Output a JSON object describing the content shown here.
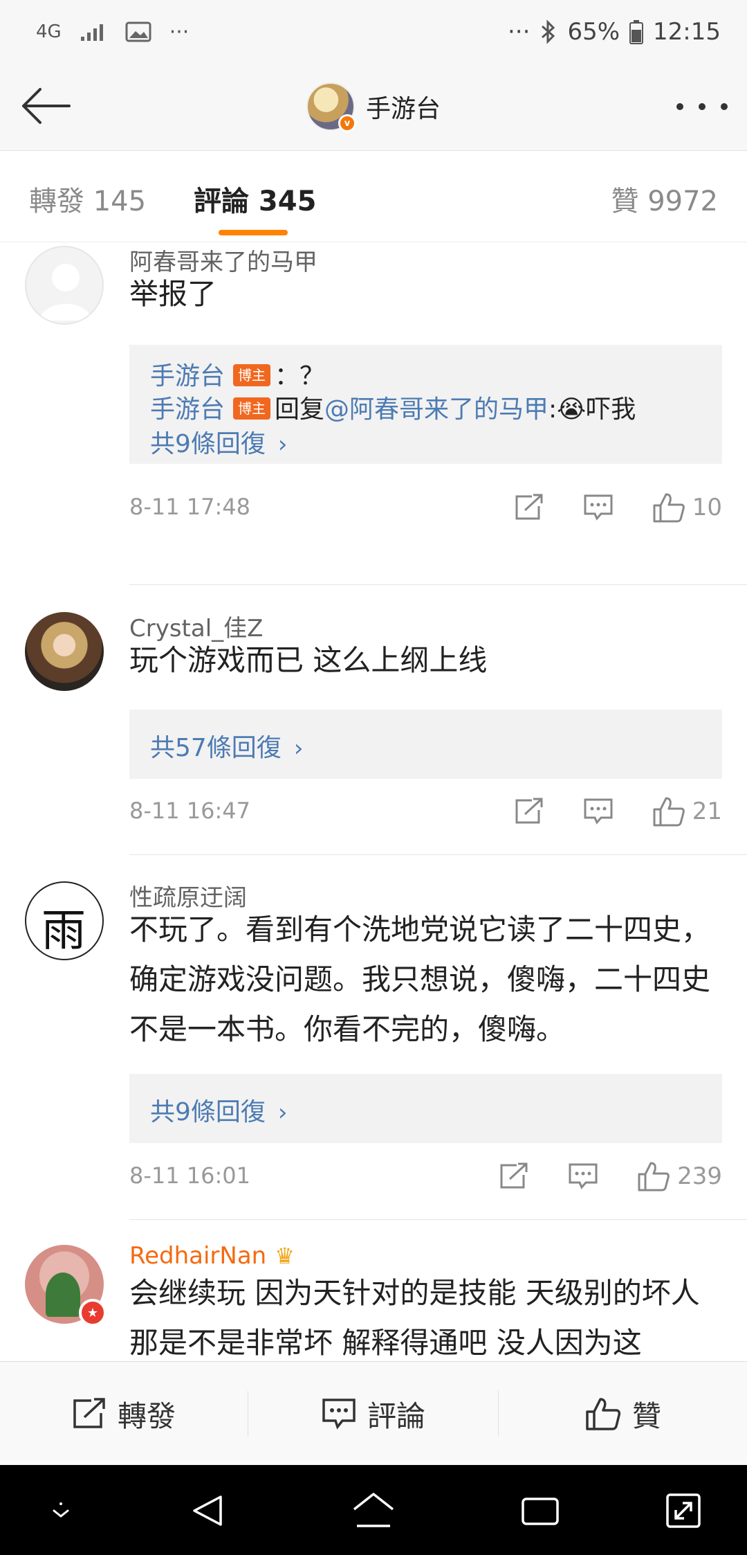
{
  "status_bar": {
    "network": "4G",
    "more": "···",
    "bt_more": "···",
    "battery": "65%",
    "time": "12:15"
  },
  "nav": {
    "title": "手游台"
  },
  "tabs": {
    "repost": "轉發 145",
    "comments": "評論 345",
    "likes": "贊 9972",
    "active": "comments",
    "accent": "#ff8200"
  },
  "comments": [
    {
      "user": "阿春哥来了的马甲",
      "text": "举报了",
      "replies": [
        {
          "name": "手游台",
          "tag": "博主",
          "content": "：？"
        },
        {
          "name": "手游台",
          "tag": "博主",
          "reply_prefix": "回复",
          "mention": "@阿春哥来了的马甲",
          "content": ":😭吓我"
        }
      ],
      "reply_more": "共9條回復",
      "time": "8-11 17:48",
      "likes": "10"
    },
    {
      "user": "Crystal_佳Z",
      "text": "玩个游戏而已 这么上纲上线",
      "reply_more": "共57條回復",
      "time": "8-11 16:47",
      "likes": "21"
    },
    {
      "user": "性疏原迂阔",
      "text": "不玩了。看到有个洗地党说它读了二十四史，确定游戏没问题。我只想说，傻嗨，二十四史不是一本书。你看不完的，傻嗨。",
      "reply_more": "共9條回復",
      "time": "8-11 16:01",
      "likes": "239"
    },
    {
      "user": "RedhairNan",
      "user_color": "#f46a0f",
      "text": "会继续玩 因为天针对的是技能 天级别的坏人那是不是非常坏 解释得通吧 没人因为这"
    }
  ],
  "bottom_bar": {
    "repost": "轉發",
    "comment": "評論",
    "like": "贊"
  },
  "colors": {
    "link": "#4d7bb3",
    "host_tag": "#f06820",
    "meta": "#999999"
  }
}
